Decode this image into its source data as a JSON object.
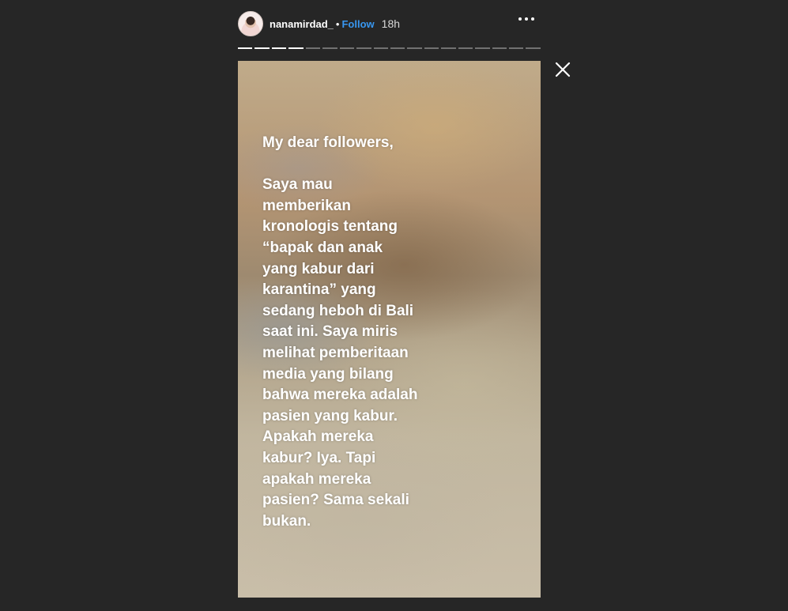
{
  "header": {
    "username": "nanamirdad_",
    "separator": "•",
    "follow_label": "Follow",
    "time": "18h",
    "more_icon": "more-horizontal-icon",
    "avatar_icon": "profile-avatar"
  },
  "progress": {
    "total_segments": 18,
    "viewed_segments": 4
  },
  "close_icon": "close-icon",
  "story": {
    "greeting": "My dear followers,",
    "lines": [
      "Saya mau",
      "memberikan",
      "kronologis tentang",
      "“bapak dan anak",
      "yang kabur dari",
      "karantina” yang",
      "sedang heboh di Bali",
      "saat ini. Saya miris",
      "melihat pemberitaan",
      "media yang bilang",
      "bahwa mereka adalah",
      "pasien yang kabur.",
      "Apakah mereka",
      "kabur? Iya. Tapi",
      "apakah mereka",
      "pasien? Sama sekali",
      "bukan."
    ]
  },
  "colors": {
    "background": "#262626",
    "follow_blue": "#3897f0",
    "text_white": "#ffffff"
  }
}
